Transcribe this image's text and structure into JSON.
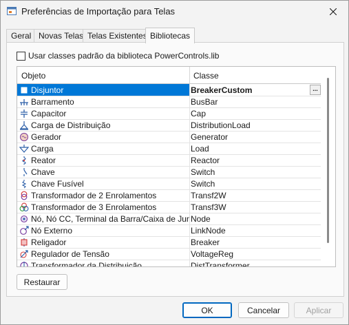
{
  "window": {
    "title": "Preferências de Importação para Telas"
  },
  "tabs": [
    {
      "label": "Geral"
    },
    {
      "label": "Novas Telas"
    },
    {
      "label": "Telas Existentes"
    },
    {
      "label": "Bibliotecas"
    }
  ],
  "checkbox": {
    "label": "Usar classes padrão da biblioteca PowerControls.lib",
    "checked": false
  },
  "grid": {
    "columns": [
      "Objeto",
      "Classe"
    ],
    "rows": [
      {
        "icon": "disjuntor-icon",
        "object": "Disjuntor",
        "class": "BreakerCustom"
      },
      {
        "icon": "barramento-icon",
        "object": "Barramento",
        "class": "BusBar"
      },
      {
        "icon": "capacitor-icon",
        "object": "Capacitor",
        "class": "Cap"
      },
      {
        "icon": "carga-distribuicao-icon",
        "object": "Carga de Distribuição",
        "class": "DistributionLoad"
      },
      {
        "icon": "gerador-icon",
        "object": "Gerador",
        "class": "Generator"
      },
      {
        "icon": "carga-icon",
        "object": "Carga",
        "class": "Load"
      },
      {
        "icon": "reator-icon",
        "object": "Reator",
        "class": "Reactor"
      },
      {
        "icon": "chave-icon",
        "object": "Chave",
        "class": "Switch"
      },
      {
        "icon": "chave-fusivel-icon",
        "object": "Chave Fusível",
        "class": "Switch"
      },
      {
        "icon": "transformador-2-icon",
        "object": "Transformador de 2 Enrolamentos",
        "class": "Transf2W"
      },
      {
        "icon": "transformador-3-icon",
        "object": "Transformador de 3 Enrolamentos",
        "class": "Transf3W"
      },
      {
        "icon": "no-icon",
        "object": "Nó, Nó CC, Terminal da Barra/Caixa de Junção",
        "class": "Node"
      },
      {
        "icon": "no-externo-icon",
        "object": "Nó Externo",
        "class": "LinkNode"
      },
      {
        "icon": "religador-icon",
        "object": "Religador",
        "class": "Breaker"
      },
      {
        "icon": "regulador-tensao-icon",
        "object": "Regulador de Tensão",
        "class": "VoltageReg"
      },
      {
        "icon": "transformador-distribuicao-icon",
        "object": "Transformador da Distribuição",
        "class": "DistTransformer"
      }
    ],
    "ellipsis": "..."
  },
  "buttons": {
    "restore": "Restaurar",
    "ok": "OK",
    "cancel": "Cancelar",
    "apply": "Aplicar"
  }
}
